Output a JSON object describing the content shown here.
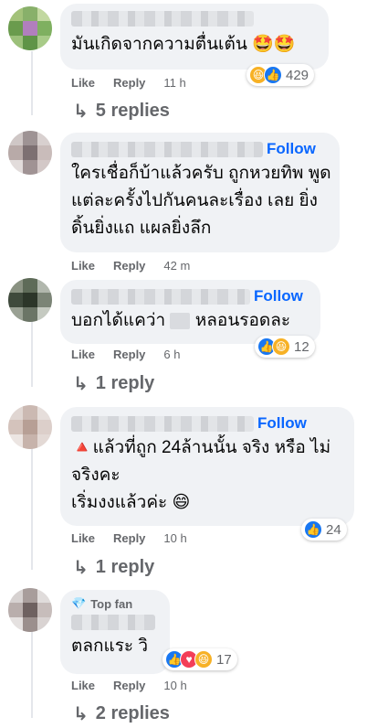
{
  "comments": [
    {
      "text": "มันเกิดจากความตื่นเต้น 🤩🤩",
      "like": "Like",
      "reply": "Reply",
      "time": "11 h",
      "reaction_count": "429",
      "reactions": [
        "haha-icon",
        "like-icon"
      ],
      "follow": "",
      "replies_label": "5 replies"
    },
    {
      "text": "ใครเชื่อก็บ้าแล้วครับ ถูกหวยทิพ พูดแต่ละครั้งไปกันคนละเรื่อง เลย ยิ่งดิ้นยิ่งแถ แผลยิ่งลึก",
      "follow": "Follow",
      "like": "Like",
      "reply": "Reply",
      "time": "42 m"
    },
    {
      "text_before": "บอกได้แคว่า",
      "text_after": "หลอนรอดละ",
      "follow": "Follow",
      "like": "Like",
      "reply": "Reply",
      "time": "6 h",
      "reaction_count": "12",
      "reactions": [
        "like-icon",
        "haha-icon"
      ],
      "replies_label": "1 reply"
    },
    {
      "text_line1": "🔺แล้วที่ถูก 24ล้านนั้น จริง หรือ ไม่จริงคะ",
      "text_line2": "เริ่มงงแล้วค่ะ 😄",
      "follow": "Follow",
      "like": "Like",
      "reply": "Reply",
      "time": "10 h",
      "reaction_count": "24",
      "reactions": [
        "like-icon"
      ],
      "replies_label": "1 reply"
    },
    {
      "badge": "Top fan",
      "text": "ตลกแระ วิ",
      "like": "Like",
      "reply": "Reply",
      "time": "10 h",
      "reaction_count": "17",
      "reactions": [
        "like-icon",
        "love-icon",
        "haha-icon"
      ],
      "replies_label": "2 replies"
    }
  ],
  "colors": {
    "accent": "#0866ff",
    "bubble": "#f0f2f5",
    "muted": "#65676b",
    "like": "#1877f2",
    "haha": "#f7b125",
    "love": "#f33e58"
  }
}
